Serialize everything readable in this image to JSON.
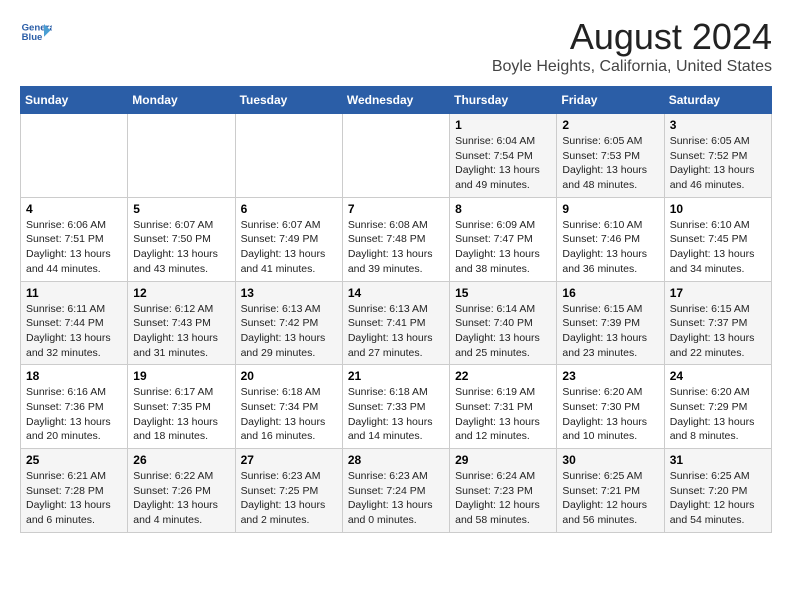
{
  "header": {
    "logo_line1": "General",
    "logo_line2": "Blue",
    "main_title": "August 2024",
    "subtitle": "Boyle Heights, California, United States"
  },
  "calendar": {
    "days_of_week": [
      "Sunday",
      "Monday",
      "Tuesday",
      "Wednesday",
      "Thursday",
      "Friday",
      "Saturday"
    ],
    "weeks": [
      [
        {
          "day": "",
          "info": ""
        },
        {
          "day": "",
          "info": ""
        },
        {
          "day": "",
          "info": ""
        },
        {
          "day": "",
          "info": ""
        },
        {
          "day": "1",
          "info": "Sunrise: 6:04 AM\nSunset: 7:54 PM\nDaylight: 13 hours\nand 49 minutes."
        },
        {
          "day": "2",
          "info": "Sunrise: 6:05 AM\nSunset: 7:53 PM\nDaylight: 13 hours\nand 48 minutes."
        },
        {
          "day": "3",
          "info": "Sunrise: 6:05 AM\nSunset: 7:52 PM\nDaylight: 13 hours\nand 46 minutes."
        }
      ],
      [
        {
          "day": "4",
          "info": "Sunrise: 6:06 AM\nSunset: 7:51 PM\nDaylight: 13 hours\nand 44 minutes."
        },
        {
          "day": "5",
          "info": "Sunrise: 6:07 AM\nSunset: 7:50 PM\nDaylight: 13 hours\nand 43 minutes."
        },
        {
          "day": "6",
          "info": "Sunrise: 6:07 AM\nSunset: 7:49 PM\nDaylight: 13 hours\nand 41 minutes."
        },
        {
          "day": "7",
          "info": "Sunrise: 6:08 AM\nSunset: 7:48 PM\nDaylight: 13 hours\nand 39 minutes."
        },
        {
          "day": "8",
          "info": "Sunrise: 6:09 AM\nSunset: 7:47 PM\nDaylight: 13 hours\nand 38 minutes."
        },
        {
          "day": "9",
          "info": "Sunrise: 6:10 AM\nSunset: 7:46 PM\nDaylight: 13 hours\nand 36 minutes."
        },
        {
          "day": "10",
          "info": "Sunrise: 6:10 AM\nSunset: 7:45 PM\nDaylight: 13 hours\nand 34 minutes."
        }
      ],
      [
        {
          "day": "11",
          "info": "Sunrise: 6:11 AM\nSunset: 7:44 PM\nDaylight: 13 hours\nand 32 minutes."
        },
        {
          "day": "12",
          "info": "Sunrise: 6:12 AM\nSunset: 7:43 PM\nDaylight: 13 hours\nand 31 minutes."
        },
        {
          "day": "13",
          "info": "Sunrise: 6:13 AM\nSunset: 7:42 PM\nDaylight: 13 hours\nand 29 minutes."
        },
        {
          "day": "14",
          "info": "Sunrise: 6:13 AM\nSunset: 7:41 PM\nDaylight: 13 hours\nand 27 minutes."
        },
        {
          "day": "15",
          "info": "Sunrise: 6:14 AM\nSunset: 7:40 PM\nDaylight: 13 hours\nand 25 minutes."
        },
        {
          "day": "16",
          "info": "Sunrise: 6:15 AM\nSunset: 7:39 PM\nDaylight: 13 hours\nand 23 minutes."
        },
        {
          "day": "17",
          "info": "Sunrise: 6:15 AM\nSunset: 7:37 PM\nDaylight: 13 hours\nand 22 minutes."
        }
      ],
      [
        {
          "day": "18",
          "info": "Sunrise: 6:16 AM\nSunset: 7:36 PM\nDaylight: 13 hours\nand 20 minutes."
        },
        {
          "day": "19",
          "info": "Sunrise: 6:17 AM\nSunset: 7:35 PM\nDaylight: 13 hours\nand 18 minutes."
        },
        {
          "day": "20",
          "info": "Sunrise: 6:18 AM\nSunset: 7:34 PM\nDaylight: 13 hours\nand 16 minutes."
        },
        {
          "day": "21",
          "info": "Sunrise: 6:18 AM\nSunset: 7:33 PM\nDaylight: 13 hours\nand 14 minutes."
        },
        {
          "day": "22",
          "info": "Sunrise: 6:19 AM\nSunset: 7:31 PM\nDaylight: 13 hours\nand 12 minutes."
        },
        {
          "day": "23",
          "info": "Sunrise: 6:20 AM\nSunset: 7:30 PM\nDaylight: 13 hours\nand 10 minutes."
        },
        {
          "day": "24",
          "info": "Sunrise: 6:20 AM\nSunset: 7:29 PM\nDaylight: 13 hours\nand 8 minutes."
        }
      ],
      [
        {
          "day": "25",
          "info": "Sunrise: 6:21 AM\nSunset: 7:28 PM\nDaylight: 13 hours\nand 6 minutes."
        },
        {
          "day": "26",
          "info": "Sunrise: 6:22 AM\nSunset: 7:26 PM\nDaylight: 13 hours\nand 4 minutes."
        },
        {
          "day": "27",
          "info": "Sunrise: 6:23 AM\nSunset: 7:25 PM\nDaylight: 13 hours\nand 2 minutes."
        },
        {
          "day": "28",
          "info": "Sunrise: 6:23 AM\nSunset: 7:24 PM\nDaylight: 13 hours\nand 0 minutes."
        },
        {
          "day": "29",
          "info": "Sunrise: 6:24 AM\nSunset: 7:23 PM\nDaylight: 12 hours\nand 58 minutes."
        },
        {
          "day": "30",
          "info": "Sunrise: 6:25 AM\nSunset: 7:21 PM\nDaylight: 12 hours\nand 56 minutes."
        },
        {
          "day": "31",
          "info": "Sunrise: 6:25 AM\nSunset: 7:20 PM\nDaylight: 12 hours\nand 54 minutes."
        }
      ]
    ]
  }
}
